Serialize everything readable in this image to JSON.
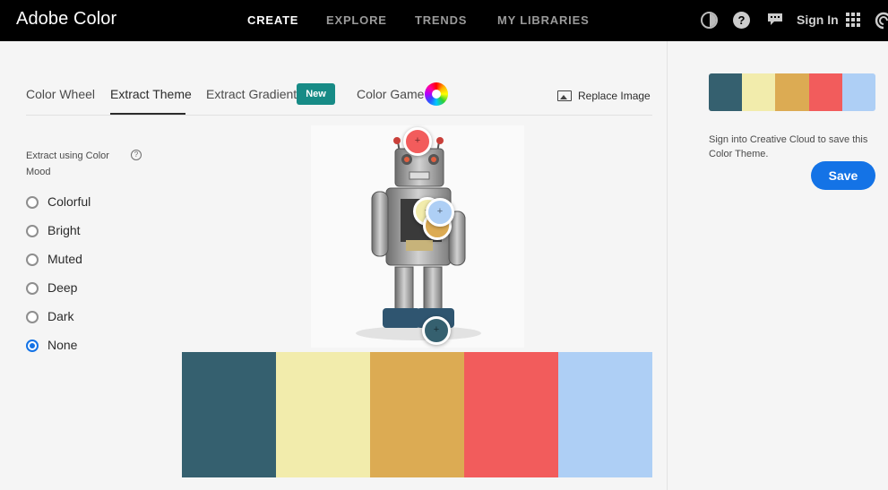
{
  "header": {
    "brand": "Adobe Color",
    "nav": [
      "CREATE",
      "EXPLORE",
      "TRENDS",
      "MY LIBRARIES"
    ],
    "help_glyph": "?",
    "signin": "Sign In",
    "icons": [
      "contrast-icon",
      "help-icon",
      "chat-icon",
      "apps-grid-icon",
      "creative-cloud-icon"
    ]
  },
  "tabs": {
    "items": [
      "Color Wheel",
      "Extract Theme",
      "Extract Gradient",
      "Color Game"
    ],
    "active": "Extract Theme",
    "new_badge": "New",
    "replace_image": "Replace Image"
  },
  "mood": {
    "label": "Extract using Color Mood",
    "help_glyph": "?",
    "options": [
      "Colorful",
      "Bright",
      "Muted",
      "Deep",
      "Dark",
      "None"
    ],
    "selected": "None"
  },
  "theme": {
    "colors": [
      "#35606f",
      "#f2ecac",
      "#dcab53",
      "#f25c5c",
      "#aecff5"
    ]
  },
  "right_panel": {
    "note": "Sign into Creative Cloud to save this Color Theme.",
    "save": "Save"
  },
  "colors": {
    "accent": "#1473e6",
    "badge": "#178b86",
    "header_bg": "#000000"
  }
}
